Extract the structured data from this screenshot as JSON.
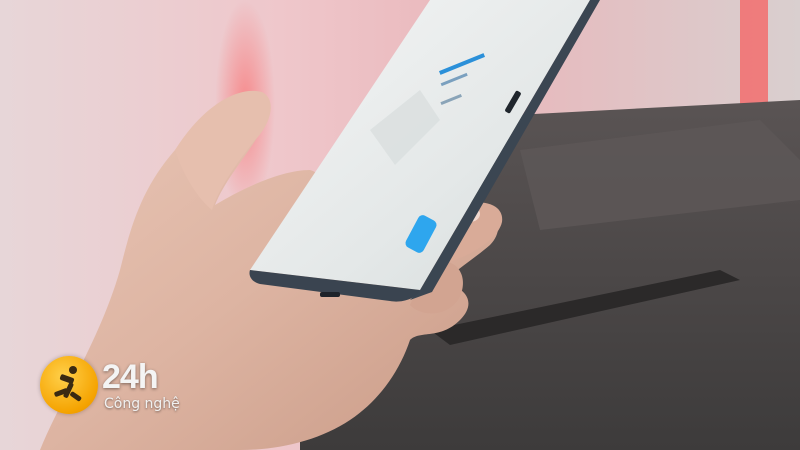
{
  "watermark": {
    "brand": "24h",
    "subtitle": "Công nghệ",
    "badge_color": "#f5a300"
  },
  "colors": {
    "background_pink": "#e9c3c6",
    "neon_red": "#ff3b3b",
    "phone_back": "#e8ecec",
    "phone_frame": "#3a4350",
    "accent_blue": "#2ea6ee",
    "table_grey": "#4e4e4e"
  }
}
